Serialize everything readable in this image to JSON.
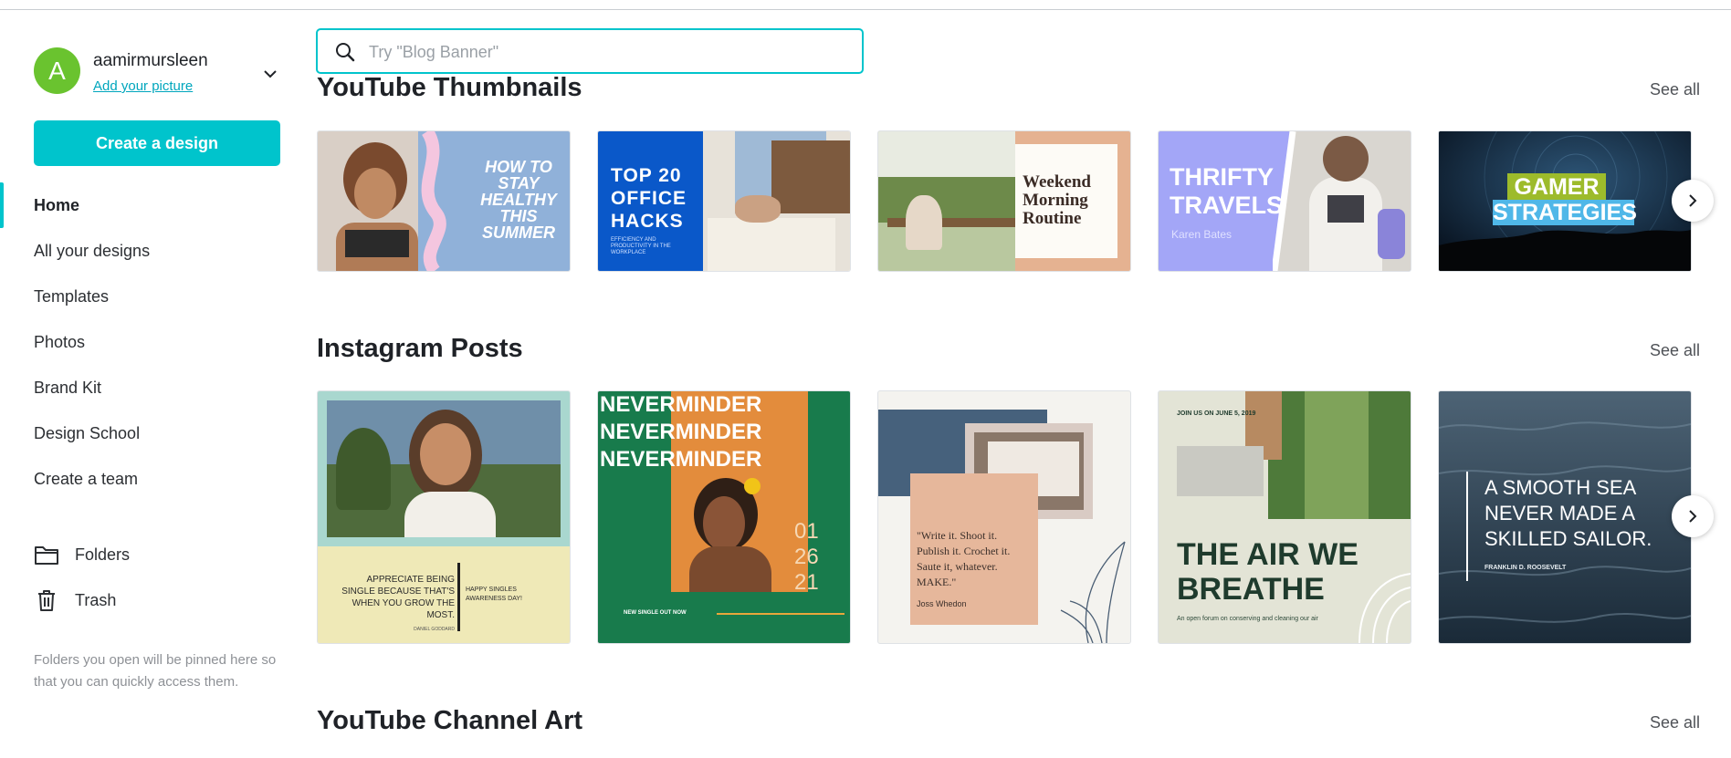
{
  "user": {
    "initial": "A",
    "name": "aamirmursleen",
    "add_picture": "Add your picture"
  },
  "sidebar": {
    "create_label": "Create a design",
    "nav": [
      "Home",
      "All your designs",
      "Templates",
      "Photos",
      "Brand Kit",
      "Design School",
      "Create a team"
    ],
    "folders_label": "Folders",
    "trash_label": "Trash",
    "pinned_note": "Folders you open will be pinned here so that you can quickly access them."
  },
  "search": {
    "placeholder": "Try \"Blog Banner\""
  },
  "sections": [
    {
      "title": "YouTube Thumbnails",
      "see_all": "See all",
      "cards": [
        {
          "name": "youtube-thumbnail-healthy",
          "text": "HOW TO STAY HEALTHY THIS SUMMER"
        },
        {
          "name": "youtube-thumbnail-office",
          "text": "TOP 20 OFFICE HACKS",
          "sub": "EFFICIENCY AND PRODUCTIVITY IN THE WORKPLACE"
        },
        {
          "name": "youtube-thumbnail-weekend",
          "text": "Weekend Morning Routine"
        },
        {
          "name": "youtube-thumbnail-travels",
          "text": "THRIFTY TRAVELS",
          "sub": "Karen Bates"
        },
        {
          "name": "youtube-thumbnail-gamer",
          "text": "GAMER",
          "text2": "STRATEGIES"
        }
      ]
    },
    {
      "title": "Instagram Posts",
      "see_all": "See all",
      "cards": [
        {
          "name": "instagram-post-single",
          "text": "APPRECIATE BEING SINGLE BECAUSE THAT'S WHEN YOU GROW THE MOST.",
          "sub": "DANIEL GODDARD",
          "side": "HAPPY SINGLES AWARENESS DAY!"
        },
        {
          "name": "instagram-post-neverminder",
          "text": "NEVERMINDER",
          "date": [
            "01",
            "26",
            "21"
          ],
          "sub": "NEW SINGLE OUT NOW"
        },
        {
          "name": "instagram-post-quote",
          "text": "\"Write it. Shoot it. Publish it. Crochet it. Saute it, whatever. MAKE.\"",
          "sub": "Joss Whedon"
        },
        {
          "name": "instagram-post-air",
          "text": "THE AIR WE BREATHE",
          "top": "JOIN US ON JUNE 5, 2019",
          "sub": "An open forum on conserving and cleaning our air"
        },
        {
          "name": "instagram-post-sea",
          "text": "A SMOOTH SEA NEVER MADE A SKILLED SAILOR.",
          "sub": "FRANKLIN D. ROOSEVELT"
        }
      ]
    },
    {
      "title": "YouTube Channel Art",
      "see_all": "See all"
    }
  ],
  "colors": {
    "accent": "#00c4cc",
    "avatar": "#6ac32f",
    "link": "#00a6bd"
  }
}
